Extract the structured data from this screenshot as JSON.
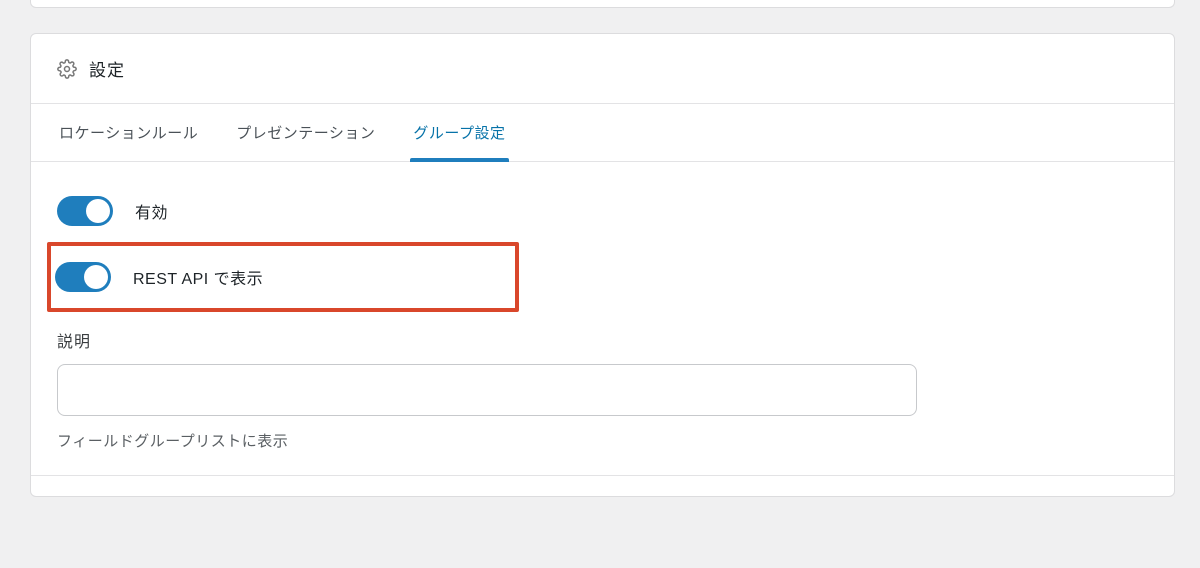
{
  "panel": {
    "title": "設定"
  },
  "tabs": {
    "location": "ロケーションルール",
    "presentation": "プレゼンテーション",
    "group": "グループ設定"
  },
  "toggles": {
    "enabled_label": "有効",
    "rest_api_label": "REST API で表示"
  },
  "description": {
    "label": "説明",
    "value": "",
    "help": "フィールドグループリストに表示"
  },
  "colors": {
    "accent": "#1f7ebd",
    "highlight_border": "#d9472b"
  }
}
